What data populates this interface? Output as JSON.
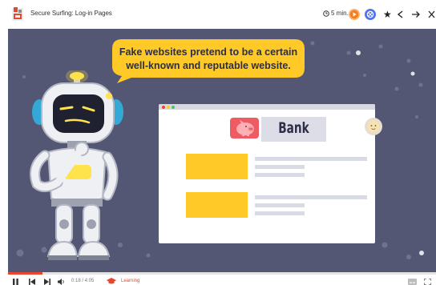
{
  "header": {
    "title": "Secure Surfing: Log-in Pages",
    "duration": "5 min.",
    "icons": [
      "app-logo-icon",
      "clock-icon",
      "play-icon",
      "share-icon",
      "star-icon",
      "back-icon",
      "forward-icon",
      "close-icon"
    ]
  },
  "slide": {
    "speech_text": "Fake websites pretend to be a certain well-known and reputable website.",
    "bank_label": "Bank"
  },
  "player": {
    "time": "0:18 / 4:05",
    "mode_label": "Learning",
    "progress": 0.08
  },
  "colors": {
    "stage_bg": "#535774",
    "speech_bubble": "#ffc928",
    "accent": "#e8462d",
    "share_blue": "#5273f1"
  }
}
